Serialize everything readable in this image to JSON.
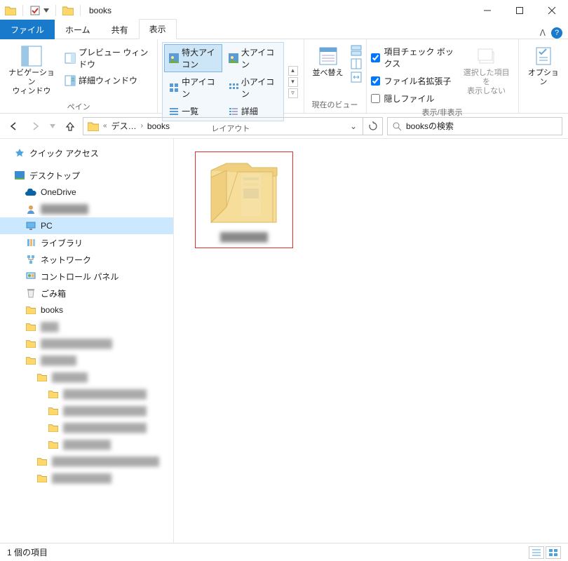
{
  "window": {
    "title": "books"
  },
  "tabs": {
    "file": "ファイル",
    "home": "ホーム",
    "share": "共有",
    "view": "表示"
  },
  "ribbon": {
    "pane_group": "ペイン",
    "nav_pane": "ナビゲーション\nウィンドウ",
    "preview_pane": "プレビュー ウィンドウ",
    "details_pane": "詳細ウィンドウ",
    "layout_group": "レイアウト",
    "layout": {
      "xlarge": "特大アイコン",
      "large": "大アイコン",
      "medium": "中アイコン",
      "small": "小アイコン",
      "list": "一覧",
      "details": "詳細"
    },
    "currentview_group": "現在のビュー",
    "sort": "並べ替え",
    "showhide_group": "表示/非表示",
    "chk_checkboxes": "項目チェック ボックス",
    "chk_extensions": "ファイル名拡張子",
    "chk_hidden": "隠しファイル",
    "hide_selected": "選択した項目を\n表示しない",
    "options": "オプション"
  },
  "address": {
    "crumb1": "デス…",
    "crumb2": "books",
    "search_placeholder": "booksの検索"
  },
  "tree": {
    "quick_access": "クイック アクセス",
    "desktop": "デスクトップ",
    "onedrive": "OneDrive",
    "user": "████████",
    "pc": "PC",
    "library": "ライブラリ",
    "network": "ネットワーク",
    "control_panel": "コントロール パネル",
    "recycle": "ごみ箱",
    "books": "books",
    "obs1": "███",
    "obs2": "████████████",
    "obs3": "██████",
    "obs4": "██████",
    "obs5": "██████████████",
    "obs6": "██████████████",
    "obs7": "██████████████",
    "obs8": "████████",
    "obs9": "██████████████████",
    "obs10": "██████████"
  },
  "content": {
    "item1_label": "████████"
  },
  "status": {
    "count": "1 個の項目"
  }
}
